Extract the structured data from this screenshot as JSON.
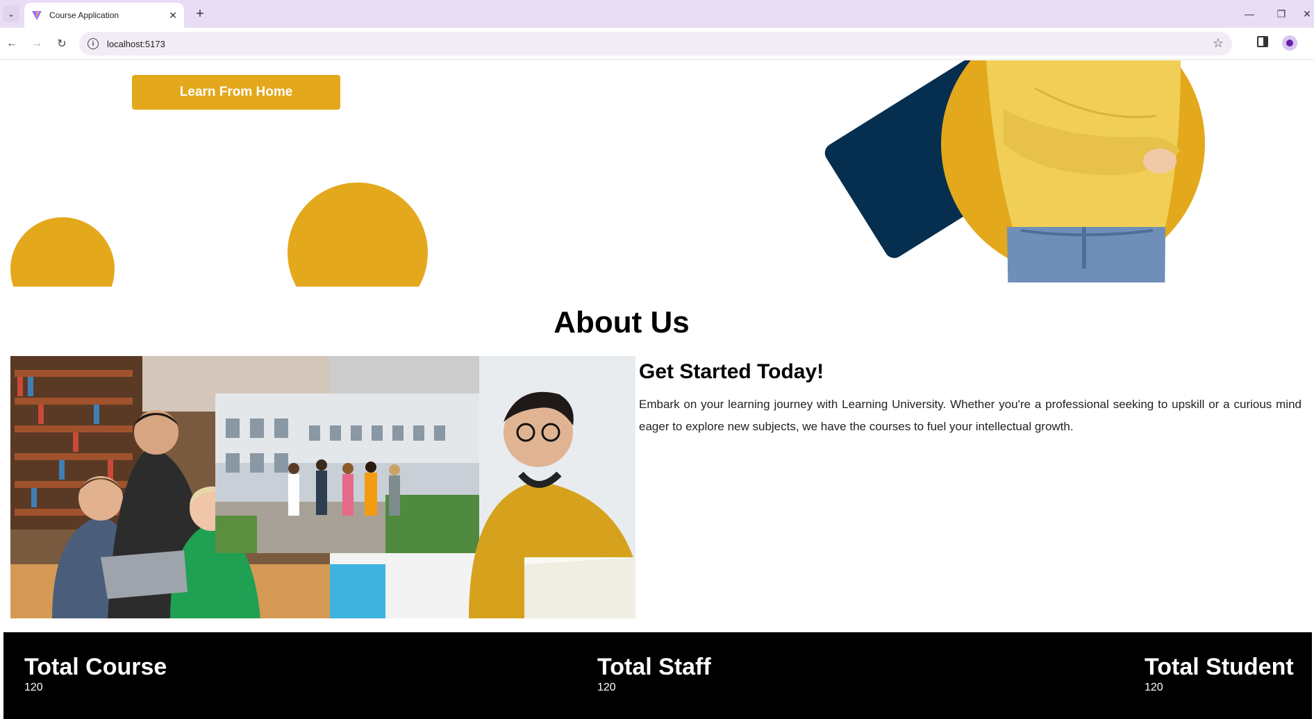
{
  "browser": {
    "tab_title": "Course Application",
    "url": "localhost:5173",
    "new_tab_symbol": "+",
    "tab_close_symbol": "✕",
    "tab_menu_symbol": "⌄"
  },
  "hero": {
    "cta_label": "Learn From Home"
  },
  "about": {
    "title": "About Us",
    "subtitle": "Get Started Today!",
    "body": "Embark on your learning journey with Learning University. Whether you're a professional seeking to upskill or a curious mind eager to explore new subjects, we have the courses to fuel your intellectual growth."
  },
  "stats": [
    {
      "label": "Total Course",
      "value": "120"
    },
    {
      "label": "Total Staff",
      "value": "120"
    },
    {
      "label": "Total Student",
      "value": "120"
    }
  ],
  "colors": {
    "accent": "#e3a81c",
    "navy": "#062e4f",
    "stats_bg": "#000000"
  }
}
